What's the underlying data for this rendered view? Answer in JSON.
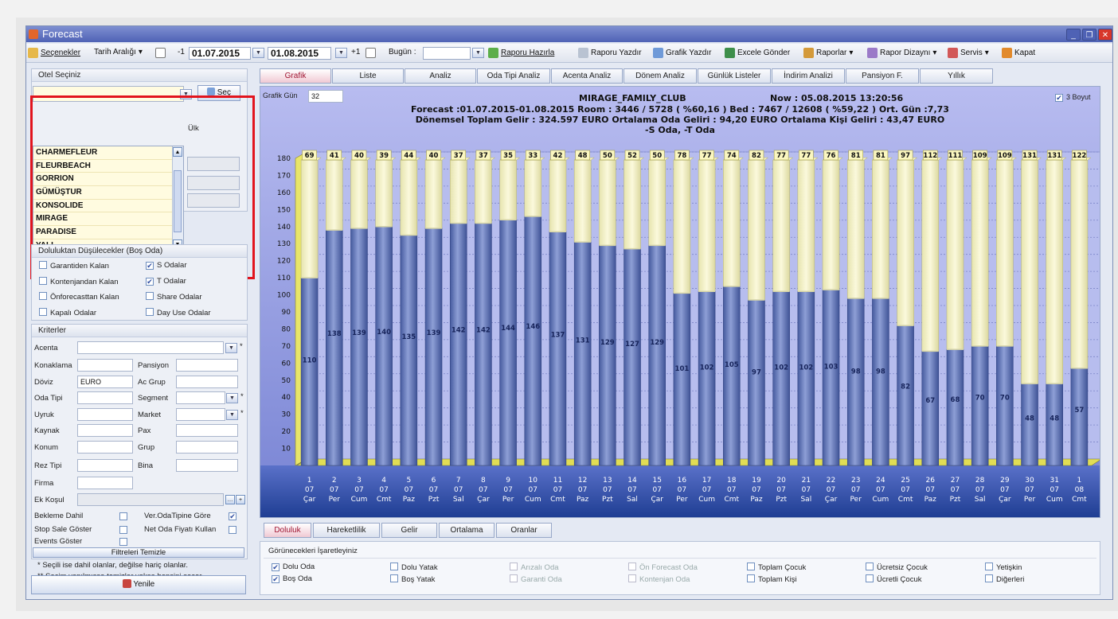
{
  "window": {
    "title": "Forecast"
  },
  "toolbar": {
    "options": "Seçenekler",
    "date_range": "Tarih Aralığı",
    "minus": "-1",
    "start_date": "01.07.2015",
    "end_date": "01.08.2015",
    "plus": "+1",
    "today_label": "Bugün :",
    "prepare": "Raporu Hazırla",
    "print_report": "Raporu Yazdır",
    "print_chart": "Grafik Yazdır",
    "send_excel": "Excele Gönder",
    "reports": "Raporlar",
    "report_design": "Rapor Dizaynı",
    "service": "Servis",
    "close": "Kapat"
  },
  "left": {
    "hotel_select_title": "Otel Seçiniz",
    "select_button": "Seç",
    "behind_text": "Ülk",
    "hotels": [
      "CHARMEFLEUR",
      "FLEURBEACH",
      "GORRION",
      "GÜMÜŞTUR",
      "KONSOLIDE",
      "MIRAGE",
      "PARADISE",
      "YALI"
    ],
    "occupancy_title": "Doluluktan Düşülecekler (Boş Oda)",
    "occ_checks": [
      {
        "label": "Garantiden Kalan",
        "checked": false
      },
      {
        "label": "S Odalar",
        "checked": true
      },
      {
        "label": "Kontenjandan Kalan",
        "checked": false
      },
      {
        "label": "T Odalar",
        "checked": true
      },
      {
        "label": "Önforecasttan Kalan",
        "checked": false
      },
      {
        "label": "Share Odalar",
        "checked": false
      },
      {
        "label": "Kapalı Odalar",
        "checked": false
      },
      {
        "label": "Day Use Odalar",
        "checked": false
      }
    ],
    "criteria_title": "Kriterler",
    "criteria": {
      "acenta": "Acenta",
      "konaklama": "Konaklama",
      "pansiyon": "Pansiyon",
      "doviz": "Döviz",
      "doviz_value": "EURO",
      "ac_grup": "Ac Grup",
      "oda_tipi": "Oda Tipi",
      "segment": "Segment",
      "uyruk": "Uyruk",
      "market": "Market",
      "kaynak": "Kaynak",
      "pax": "Pax",
      "konum": "Konum",
      "grup": "Grup",
      "rez_tipi": "Rez Tipi",
      "bina": "Bina",
      "firma": "Firma",
      "ek_kosul": "Ek Koşul"
    },
    "options": {
      "bekleme": "Bekleme Dahil",
      "ver_oda": "Ver.OdaTipine Göre",
      "stop_sale": "Stop Sale Göster",
      "net_oda": "Net Oda Fiyatı Kullan",
      "events": "Events Göster"
    },
    "clear_filters": "Filtreleri Temizle",
    "note1": "*  Seçili ise dahil olanlar, değilse hariç olanlar.",
    "note2": "** Seçim yapılmışsa temizler yoksa hepsini seçer",
    "refresh": "Yenile"
  },
  "tabs": [
    "Grafik",
    "Liste",
    "Analiz",
    "Oda Tipi Analiz",
    "Acenta Analiz",
    "Dönem Analiz",
    "Günlük Listeler",
    "İndirim Analizi",
    "Pansiyon F.",
    "Yıllık"
  ],
  "chart_panel": {
    "days_label": "Grafik Gün",
    "days_value": "32",
    "three_d_label": "3 Boyut",
    "header_line1_a": "MIRAGE_FAMILY_CLUB",
    "header_line1_b": "Now : 05.08.2015 13:20:56",
    "header_line2": "Forecast :01.07.2015-01.08.2015      Room : 3446 / 5728 ( %60,16 )          Bed : 7467 / 12608 ( %59,22 )  Ort. Gün :7,73",
    "header_line3": "Dönemsel Toplam Gelir : 324.597 EURO      Ortalama Oda Geliri : 94,20 EURO      Ortalama Kişi Geliri : 43,47 EURO",
    "header_line4": "-S Oda, -T Oda"
  },
  "chart_data": {
    "type": "bar",
    "stacked": true,
    "ylim": [
      0,
      180
    ],
    "yticks": [
      10,
      20,
      30,
      40,
      50,
      60,
      70,
      80,
      90,
      100,
      110,
      120,
      130,
      140,
      150,
      160,
      170,
      180
    ],
    "grid": true,
    "categories": [
      [
        "1",
        "07",
        "Çar"
      ],
      [
        "2",
        "07",
        "Per"
      ],
      [
        "3",
        "07",
        "Cum"
      ],
      [
        "4",
        "07",
        "Cmt"
      ],
      [
        "5",
        "07",
        "Paz"
      ],
      [
        "6",
        "07",
        "Pzt"
      ],
      [
        "7",
        "07",
        "Sal"
      ],
      [
        "8",
        "07",
        "Çar"
      ],
      [
        "9",
        "07",
        "Per"
      ],
      [
        "10",
        "07",
        "Cum"
      ],
      [
        "11",
        "07",
        "Cmt"
      ],
      [
        "12",
        "07",
        "Paz"
      ],
      [
        "13",
        "07",
        "Pzt"
      ],
      [
        "14",
        "07",
        "Sal"
      ],
      [
        "15",
        "07",
        "Çar"
      ],
      [
        "16",
        "07",
        "Per"
      ],
      [
        "17",
        "07",
        "Cum"
      ],
      [
        "18",
        "07",
        "Cmt"
      ],
      [
        "19",
        "07",
        "Paz"
      ],
      [
        "20",
        "07",
        "Pzt"
      ],
      [
        "21",
        "07",
        "Sal"
      ],
      [
        "22",
        "07",
        "Çar"
      ],
      [
        "23",
        "07",
        "Per"
      ],
      [
        "24",
        "07",
        "Cum"
      ],
      [
        "25",
        "07",
        "Cmt"
      ],
      [
        "26",
        "07",
        "Paz"
      ],
      [
        "27",
        "07",
        "Pzt"
      ],
      [
        "28",
        "07",
        "Sal"
      ],
      [
        "29",
        "07",
        "Çar"
      ],
      [
        "30",
        "07",
        "Per"
      ],
      [
        "31",
        "07",
        "Cum"
      ],
      [
        "1",
        "08",
        "Cmt"
      ]
    ],
    "series": [
      {
        "name": "Dolu Oda",
        "color": "#5e74b8",
        "values": [
          110,
          138,
          139,
          140,
          135,
          139,
          142,
          142,
          144,
          146,
          137,
          131,
          129,
          127,
          129,
          101,
          102,
          105,
          97,
          102,
          102,
          103,
          98,
          98,
          82,
          67,
          68,
          70,
          70,
          48,
          48,
          57
        ]
      },
      {
        "name": "Bos Oda",
        "color": "#f1f0c6",
        "values": [
          69,
          41,
          40,
          39,
          44,
          40,
          37,
          37,
          35,
          33,
          42,
          48,
          50,
          52,
          50,
          78,
          77,
          74,
          82,
          77,
          77,
          76,
          81,
          81,
          97,
          112,
          111,
          109,
          109,
          131,
          131,
          122
        ]
      }
    ]
  },
  "bottom_tabs": [
    "Doluluk",
    "Hareketlilik",
    "Gelir",
    "Ortalama",
    "Oranlar"
  ],
  "filters": {
    "title": "Görünecekleri İşaretleyiniz",
    "items": [
      {
        "label": "Dolu Oda",
        "checked": true,
        "disabled": false
      },
      {
        "label": "Dolu Yatak",
        "checked": false,
        "disabled": false
      },
      {
        "label": "Arızalı Oda",
        "checked": false,
        "disabled": true
      },
      {
        "label": "Ön Forecast Oda",
        "checked": false,
        "disabled": true
      },
      {
        "label": "Toplam Çocuk",
        "checked": false,
        "disabled": false
      },
      {
        "label": "Ücretsiz Çocuk",
        "checked": false,
        "disabled": false
      },
      {
        "label": "Yetişkin",
        "checked": false,
        "disabled": false
      },
      {
        "label": "Boş Oda",
        "checked": true,
        "disabled": false
      },
      {
        "label": "Boş Yatak",
        "checked": false,
        "disabled": false
      },
      {
        "label": "Garanti Oda",
        "checked": false,
        "disabled": true
      },
      {
        "label": "Kontenjan Oda",
        "checked": false,
        "disabled": true
      },
      {
        "label": "Toplam Kişi",
        "checked": false,
        "disabled": false
      },
      {
        "label": "Ücretli Çocuk",
        "checked": false,
        "disabled": false
      },
      {
        "label": "Diğerleri",
        "checked": false,
        "disabled": false
      }
    ]
  }
}
